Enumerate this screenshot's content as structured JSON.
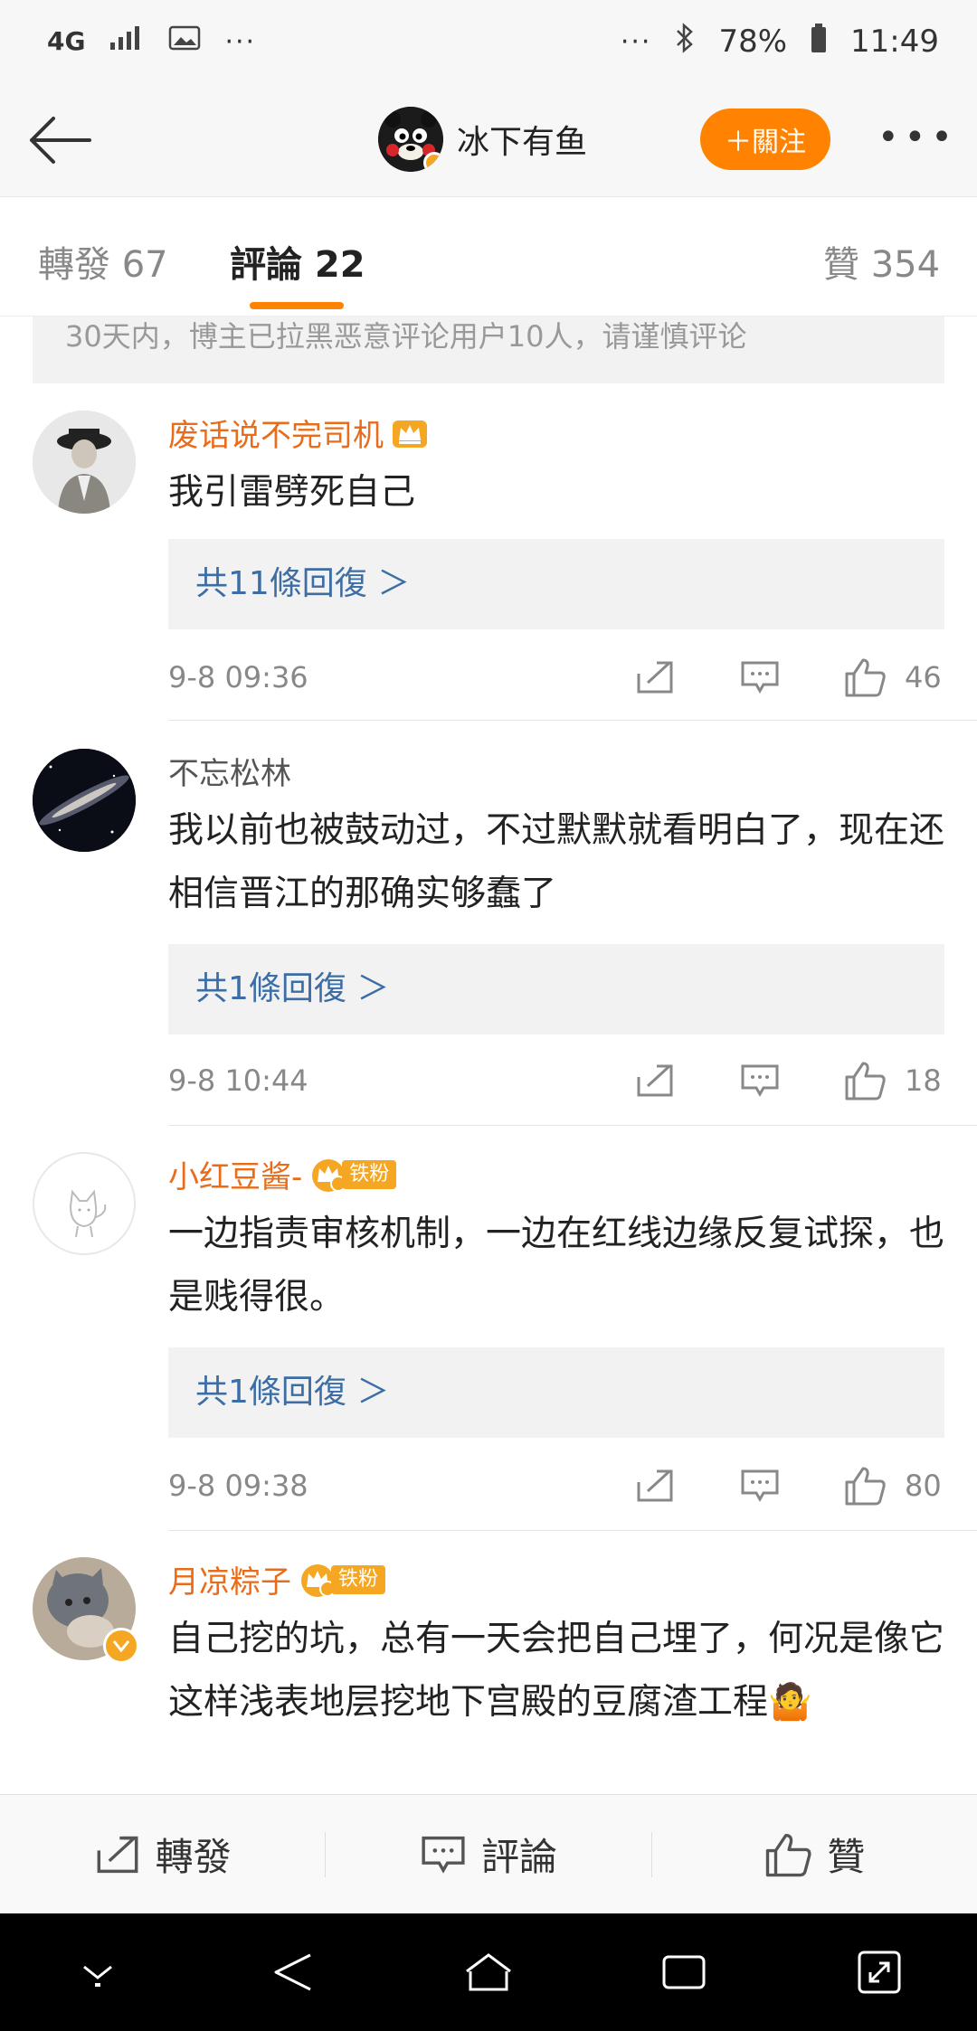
{
  "status_bar": {
    "network": "4G",
    "more_dots": "···",
    "right_dots": "···",
    "battery": "78%",
    "time": "11:49"
  },
  "nav": {
    "title": "冰下有鱼",
    "follow_label": "＋關注",
    "more": "•••"
  },
  "tabs": {
    "repost": "轉發 67",
    "comments": "評論 22",
    "likes": "贊 354"
  },
  "notice": "30天内，博主已拉黑恶意评论用户10人，请谨慎评论",
  "comments": [
    {
      "username": "废话说不完司机",
      "content": "我引雷劈死自己",
      "replies": "共11條回復 ＞",
      "time": "9-8 09:36",
      "likes": "46"
    },
    {
      "username": "不忘松林",
      "content": "我以前也被鼓动过，不过默默就看明白了，现在还相信晋江的那确实够蠢了",
      "replies": "共1條回復 ＞",
      "time": "9-8 10:44",
      "likes": "18"
    },
    {
      "username": "小红豆酱-",
      "fan_tag": "铁粉",
      "content": "一边指责审核机制，一边在红线边缘反复试探，也是贱得很。",
      "replies": "共1條回復 ＞",
      "time": "9-8 09:38",
      "likes": "80"
    },
    {
      "username": "月凉粽子",
      "fan_tag": "铁粉",
      "content": "自己挖的坑，总有一天会把自己埋了，何况是像它这样浅表地层挖地下宫殿的豆腐渣工程🤷"
    }
  ],
  "actions": {
    "repost": "轉發",
    "comment": "評論",
    "like": "贊"
  },
  "colors": {
    "accent": "#ff8200",
    "username_vip": "#e86c1a",
    "reply_link": "#3c6ea5"
  }
}
